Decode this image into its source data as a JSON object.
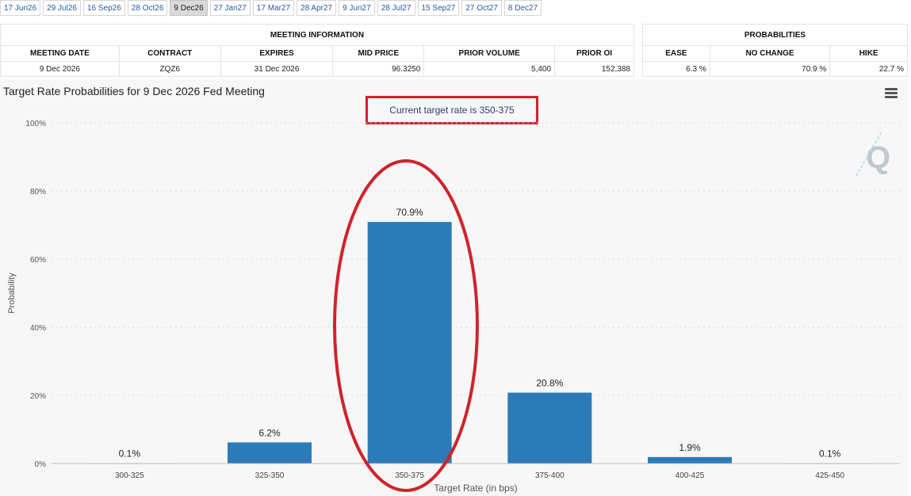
{
  "tabs": [
    {
      "label": "17 Jun26",
      "active": false
    },
    {
      "label": "29 Jul26",
      "active": false
    },
    {
      "label": "16 Sep26",
      "active": false
    },
    {
      "label": "28 Oct26",
      "active": false
    },
    {
      "label": "9 Dec26",
      "active": true
    },
    {
      "label": "27 Jan27",
      "active": false
    },
    {
      "label": "17 Mar27",
      "active": false
    },
    {
      "label": "28 Apr27",
      "active": false
    },
    {
      "label": "9 Jun27",
      "active": false
    },
    {
      "label": "28 Jul27",
      "active": false
    },
    {
      "label": "15 Sep27",
      "active": false
    },
    {
      "label": "27 Oct27",
      "active": false
    },
    {
      "label": "8 Dec27",
      "active": false
    }
  ],
  "meeting_info": {
    "title": "MEETING INFORMATION",
    "headers": [
      "MEETING DATE",
      "CONTRACT",
      "EXPIRES",
      "MID PRICE",
      "PRIOR VOLUME",
      "PRIOR OI"
    ],
    "row": [
      "9 Dec 2026",
      "ZQZ6",
      "31 Dec 2026",
      "96.3250",
      "5,400",
      "152,388"
    ]
  },
  "probabilities": {
    "title": "PROBABILITIES",
    "headers": [
      "EASE",
      "NO CHANGE",
      "HIKE"
    ],
    "row": [
      "6.3 %",
      "70.9 %",
      "22.7 %"
    ]
  },
  "chart_panel": {
    "current_rate_note": "Current target rate is 350-375"
  },
  "colors": {
    "bar": "#2b7bb9",
    "highlight": "#d0232b",
    "tab_link": "#2a5b9e"
  },
  "icons": {
    "menu": "hamburger-menu-icon",
    "watermark": "quikstrike-q-logo"
  },
  "chart_data": {
    "type": "bar",
    "title": "Target Rate Probabilities for 9 Dec 2026 Fed Meeting",
    "xlabel": "Target Rate (in bps)",
    "ylabel": "Probability",
    "categories": [
      "300-325",
      "325-350",
      "350-375",
      "375-400",
      "400-425",
      "425-450"
    ],
    "values": [
      0.1,
      6.2,
      70.9,
      20.8,
      1.9,
      0.1
    ],
    "data_labels": [
      "0.1%",
      "6.2%",
      "70.9%",
      "20.8%",
      "1.9%",
      "0.1%"
    ],
    "ylim": [
      0,
      100
    ],
    "yticks": [
      0,
      20,
      40,
      60,
      80,
      100
    ],
    "ytick_labels": [
      "0%",
      "20%",
      "40%",
      "60%",
      "80%",
      "100%"
    ],
    "grid": true,
    "highlighted_category": "350-375"
  }
}
